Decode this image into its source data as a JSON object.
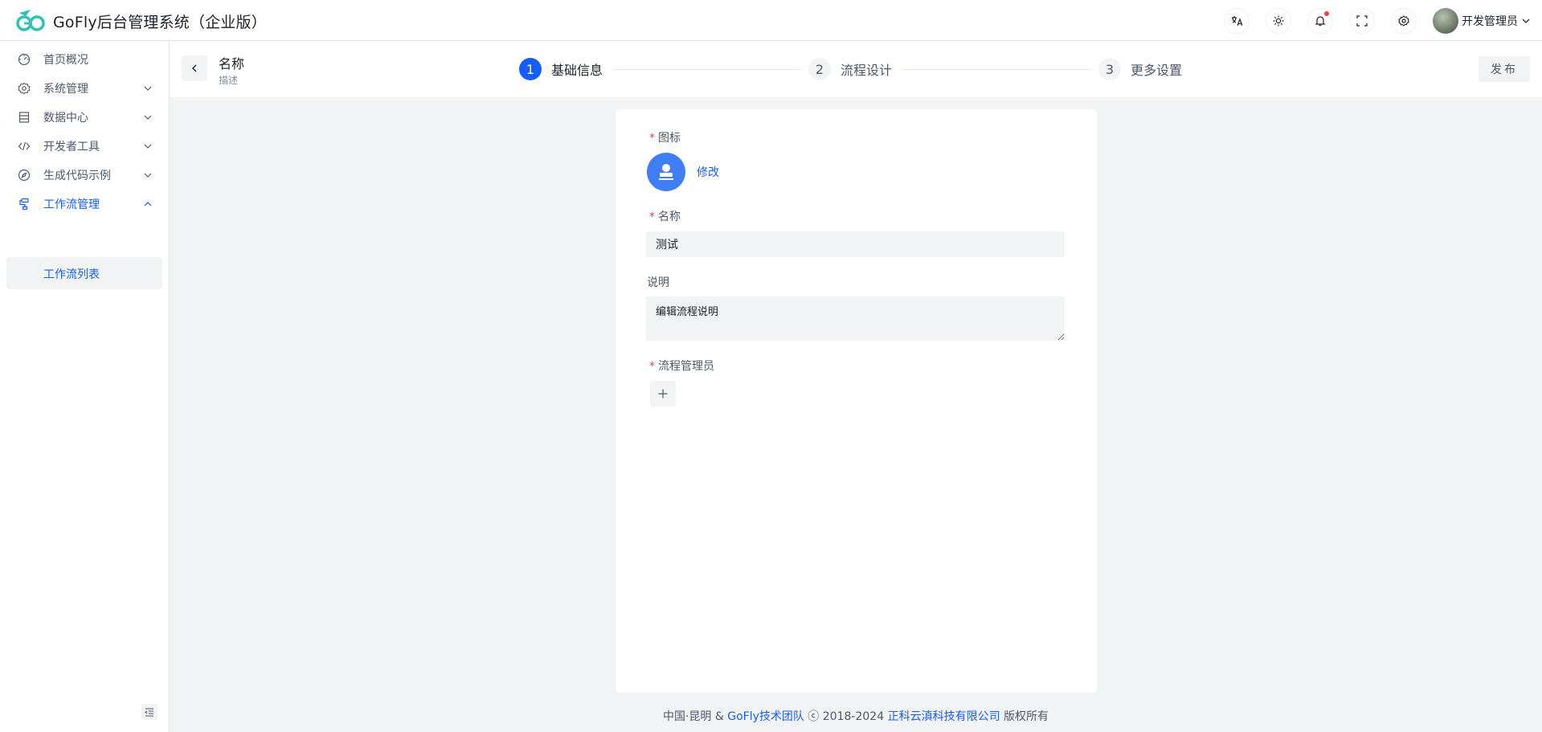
{
  "header": {
    "title": "GoFly后台管理系统（企业版）",
    "icons": [
      "translate-icon",
      "theme-icon",
      "bell-icon",
      "fullscreen-icon",
      "settings-icon"
    ],
    "user_name": "开发管理员"
  },
  "sidebar": {
    "items": [
      {
        "label": "首页概况",
        "icon": "dashboard-icon"
      },
      {
        "label": "系统管理",
        "icon": "gear-icon"
      },
      {
        "label": "数据中心",
        "icon": "database-icon"
      },
      {
        "label": "开发者工具",
        "icon": "code-icon"
      },
      {
        "label": "生成代码示例",
        "icon": "compass-icon"
      },
      {
        "label": "工作流管理",
        "icon": "workflow-icon"
      }
    ],
    "sub_item": "工作流列表"
  },
  "topbar": {
    "name": "名称",
    "desc": "描述",
    "steps": [
      {
        "num": "1",
        "label": "基础信息"
      },
      {
        "num": "2",
        "label": "流程设计"
      },
      {
        "num": "3",
        "label": "更多设置"
      }
    ],
    "publish": "发布"
  },
  "form": {
    "icon_label": "图标",
    "modify": "修改",
    "name_label": "名称",
    "name_value": "测试",
    "desc_label": "说明",
    "desc_value": "编辑流程说明",
    "admin_label": "流程管理员"
  },
  "footer": {
    "prefix": "中国·昆明 & ",
    "team": "GoFly技术团队",
    "copyright": " ⓒ 2018-2024 ",
    "company": "正科云滇科技有限公司",
    "suffix": " 版权所有"
  },
  "colors": {
    "accent": "#165dff",
    "required": "#f53f3f",
    "icon_bg": "#3f7ef7"
  }
}
